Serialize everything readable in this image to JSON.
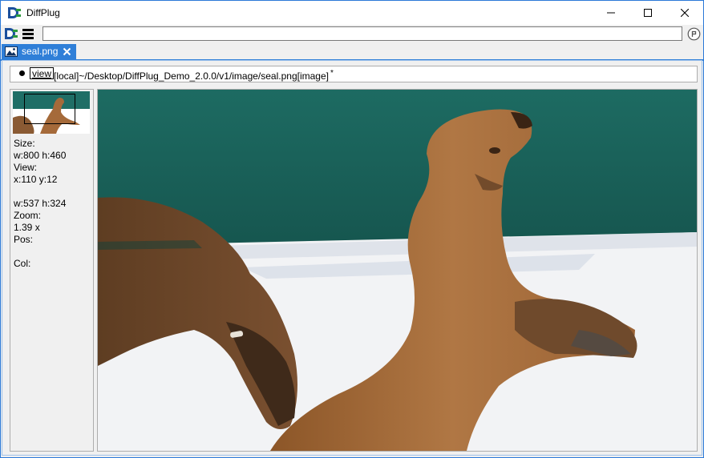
{
  "window": {
    "title": "DiffPlug",
    "icons": [
      "diffplug-logo-icon",
      "minimize-icon",
      "maximize-icon",
      "close-icon"
    ]
  },
  "toolbar": {
    "icons": [
      "diffplug-logo-icon",
      "hamburger-menu-icon",
      "go-icon"
    ],
    "command_value": "",
    "command_placeholder": ""
  },
  "tabs": [
    {
      "label": "seal.png",
      "icon": "image-icon",
      "active": true
    }
  ],
  "pathbar": {
    "view_label": "view",
    "path": "[local]~/Desktop/DiffPlug_Demo_2.0.0/v1/image/seal.png[image]",
    "marker": "*"
  },
  "info": {
    "size_label": "Size:",
    "size_value": "w:800 h:460",
    "view_label": "View:",
    "view_pos": "x:110 y:12",
    "view_dims": "w:537 h:324",
    "zoom_label": "Zoom:",
    "zoom_value": "1.39 x",
    "pos_label": "Pos:",
    "pos_value": "",
    "col_label": "Col:",
    "col_value": ""
  },
  "colors": {
    "accent": "#2f7fd8",
    "logo_green": "#2b9a3c",
    "logo_blue": "#1b4f9c",
    "water": "#1f6e66",
    "seal_brown": "#a56a3a"
  }
}
